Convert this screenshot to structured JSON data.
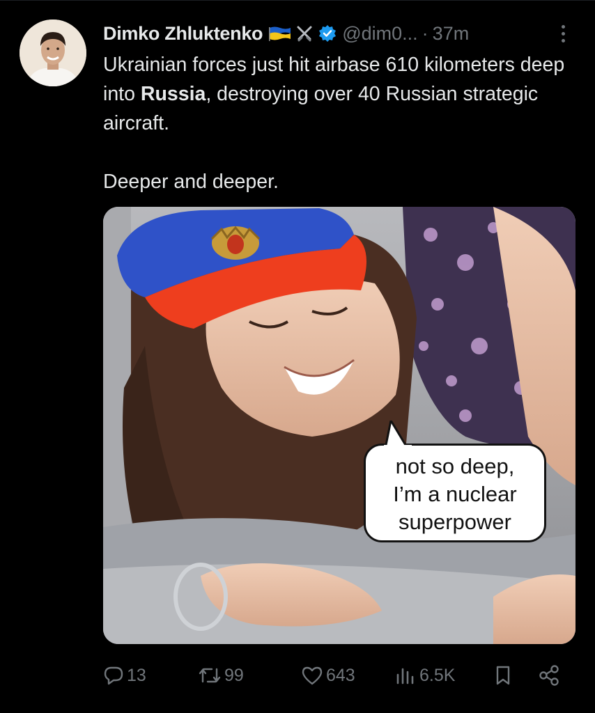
{
  "author": {
    "name": "Dimko Zhluktenko",
    "handle": "@dim0...",
    "separator": "·",
    "time": "37m"
  },
  "tweet": {
    "line1": "Ukrainian forces just hit airbase 610 kilometers deep into ",
    "bold": "Russia",
    "line1_end": ", destroying over 40 Russian strategic aircraft.",
    "line2": "Deeper and deeper."
  },
  "media": {
    "caption_lines": [
      "not so deep,",
      "I’m a nuclear",
      "superpower"
    ]
  },
  "actions": {
    "replies": "13",
    "reposts": "99",
    "likes": "643",
    "views": "6.5K"
  },
  "colors": {
    "background": "#000000",
    "text": "#e7e9ea",
    "secondary": "#71767b",
    "verified": "#1d9bf0"
  },
  "icons": [
    "reply-icon",
    "repost-icon",
    "like-icon",
    "views-icon",
    "bookmark-icon",
    "share-icon",
    "verified-badge-icon",
    "ukraine-flag-icon",
    "crossed-swords-icon",
    "more-icon"
  ]
}
